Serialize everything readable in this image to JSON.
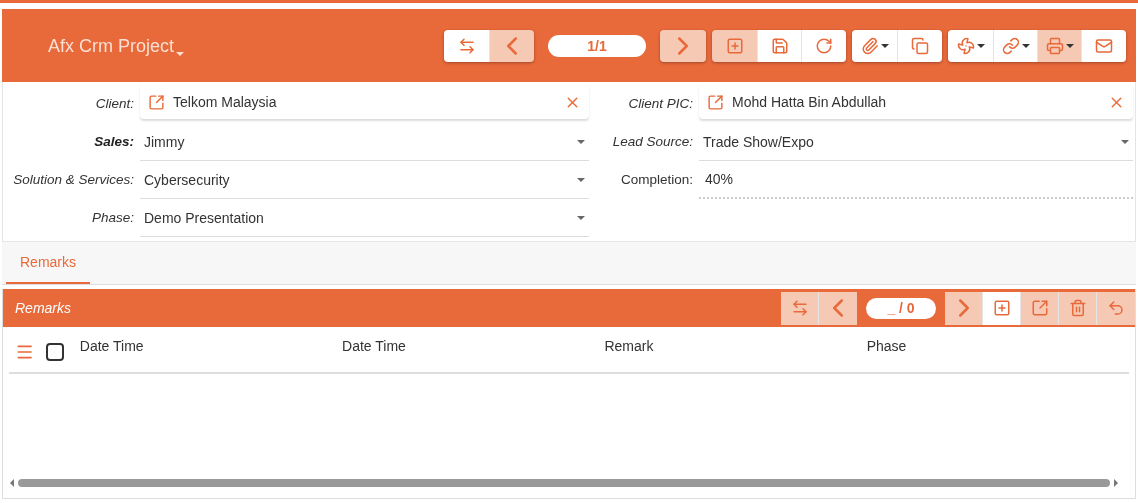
{
  "header": {
    "title": "Afx Crm Project",
    "pager": "1/1",
    "toolbar": [
      [
        {
          "kind": "swap",
          "disabled": false
        },
        {
          "kind": "prev",
          "disabled": true
        }
      ],
      [
        {
          "kind": "next",
          "disabled": true
        }
      ],
      [
        {
          "kind": "add",
          "disabled": true
        },
        {
          "kind": "save",
          "disabled": false
        },
        {
          "kind": "refresh",
          "disabled": false
        }
      ],
      [
        {
          "kind": "attach",
          "disabled": false
        },
        {
          "kind": "copy",
          "disabled": false
        }
      ],
      [
        {
          "kind": "fan",
          "disabled": false
        },
        {
          "kind": "link",
          "disabled": false
        },
        {
          "kind": "print",
          "disabled": true
        },
        {
          "kind": "mail",
          "disabled": false
        }
      ]
    ]
  },
  "form": {
    "left": [
      {
        "label": "Client:",
        "kind": "lookup",
        "value": "Telkom Malaysia",
        "required": false
      },
      {
        "label": "Sales:",
        "kind": "select",
        "value": "Jimmy",
        "required": true
      },
      {
        "label": "Solution & Services:",
        "kind": "select",
        "value": "Cybersecurity",
        "required": false
      },
      {
        "label": "Phase:",
        "kind": "select",
        "value": "Demo Presentation",
        "required": false
      }
    ],
    "right": [
      {
        "label": "Client PIC:",
        "kind": "lookup",
        "value": "Mohd Hatta Bin Abdullah",
        "required": false
      },
      {
        "label": "Lead Source:",
        "kind": "select",
        "value": "Trade Show/Expo",
        "required": false
      },
      {
        "label": "Completion:",
        "kind": "text",
        "value": "40%",
        "required": false
      }
    ]
  },
  "tabs": [
    {
      "label": "Remarks",
      "selected": true
    }
  ],
  "remarks": {
    "title": "Remarks",
    "pager": "_ / 0",
    "toolbar": [
      [
        {
          "kind": "swap",
          "disabled": true
        },
        {
          "kind": "prev",
          "disabled": true
        }
      ],
      [
        {
          "kind": "next",
          "disabled": true
        },
        {
          "kind": "add",
          "disabled": false
        },
        {
          "kind": "open",
          "disabled": true
        },
        {
          "kind": "delete",
          "disabled": true
        },
        {
          "kind": "undo",
          "disabled": true
        }
      ]
    ],
    "columns": [
      "Date Time",
      "Date Time",
      "Remark",
      "Phase"
    ],
    "select_all": {
      "checked": false
    }
  }
}
